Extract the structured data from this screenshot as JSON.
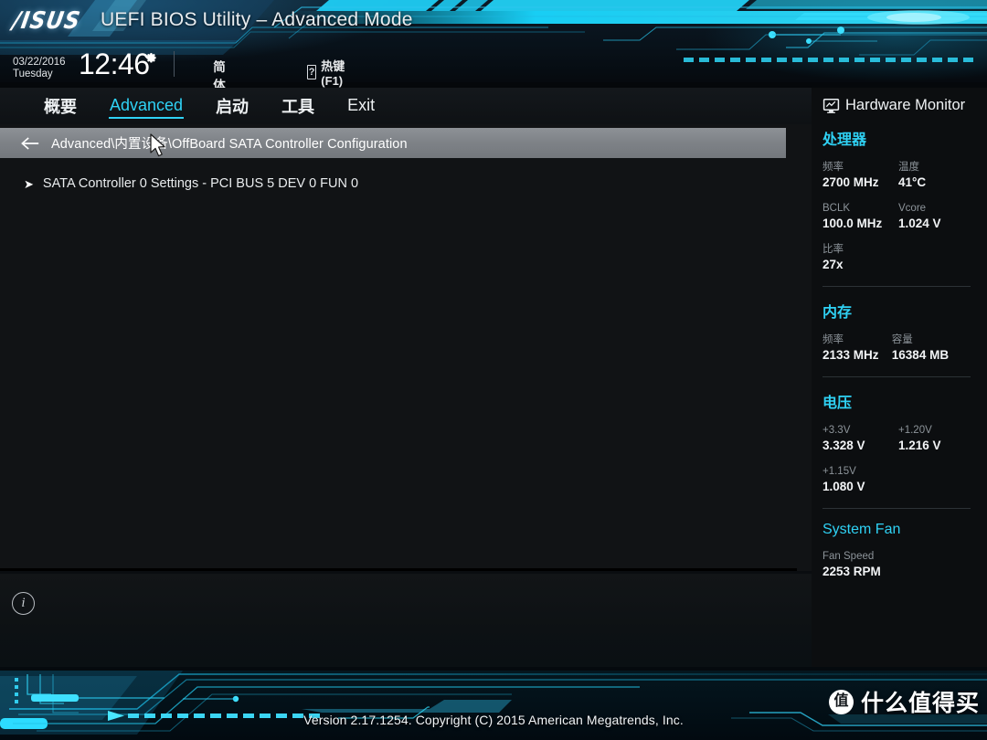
{
  "header": {
    "brand": "/ISUS",
    "title": "UEFI BIOS Utility – Advanced Mode",
    "date": "03/22/2016",
    "weekday": "Tuesday",
    "time": "12:46",
    "gear_icon": "gear-icon",
    "language": {
      "icon": "globe-icon",
      "label": "简体中文"
    },
    "hotkey": {
      "icon": "question-box-icon",
      "label": "热键(F1)"
    }
  },
  "tabs": [
    {
      "label": "概要",
      "active": false,
      "latin": false
    },
    {
      "label": "Advanced",
      "active": true,
      "latin": true
    },
    {
      "label": "启动",
      "active": false,
      "latin": false
    },
    {
      "label": "工具",
      "active": false,
      "latin": false
    },
    {
      "label": "Exit",
      "active": false,
      "latin": true
    }
  ],
  "main": {
    "back_icon": "back-arrow-icon",
    "breadcrumb": "Advanced\\内置设备\\OffBoard SATA Controller Configuration",
    "items": [
      {
        "chevron": "➤",
        "label": "SATA Controller 0 Settings - PCI BUS 5 DEV 0 FUN 0"
      }
    ],
    "info_icon": "info-icon"
  },
  "hardware_monitor": {
    "icon": "monitor-chart-icon",
    "title": "Hardware Monitor",
    "sections": [
      {
        "name": "处理器",
        "latin": false,
        "rows": [
          [
            {
              "label": "频率",
              "value": "2700 MHz"
            },
            {
              "label": "温度",
              "value": "41°C"
            }
          ],
          [
            {
              "label": "BCLK",
              "value": "100.0 MHz"
            },
            {
              "label": "Vcore",
              "value": "1.024 V"
            }
          ],
          [
            {
              "label": "比率",
              "value": "27x"
            }
          ]
        ]
      },
      {
        "name": "内存",
        "latin": false,
        "rows": [
          [
            {
              "label": "频率",
              "value": "2133 MHz"
            },
            {
              "label": "容量",
              "value": "16384 MB"
            }
          ]
        ]
      },
      {
        "name": "电压",
        "latin": false,
        "rows": [
          [
            {
              "label": "+3.3V",
              "value": "3.328 V"
            },
            {
              "label": "+1.20V",
              "value": "1.216 V"
            }
          ],
          [
            {
              "label": "+1.15V",
              "value": "1.080 V"
            }
          ]
        ]
      },
      {
        "name": "System Fan",
        "latin": true,
        "rows": [
          [
            {
              "label": "Fan Speed",
              "value": "2253 RPM"
            }
          ]
        ]
      }
    ]
  },
  "footer": {
    "version": "Version 2.17.1254. Copyright (C) 2015 American Megatrends, Inc.",
    "watermark_badge": "值",
    "watermark_text": "什么值得买"
  },
  "colors": {
    "accent": "#2fd2f5",
    "bg": "#111315",
    "sidebar_bg": "#0c0e10",
    "crumb_bg": "#7e8287"
  }
}
